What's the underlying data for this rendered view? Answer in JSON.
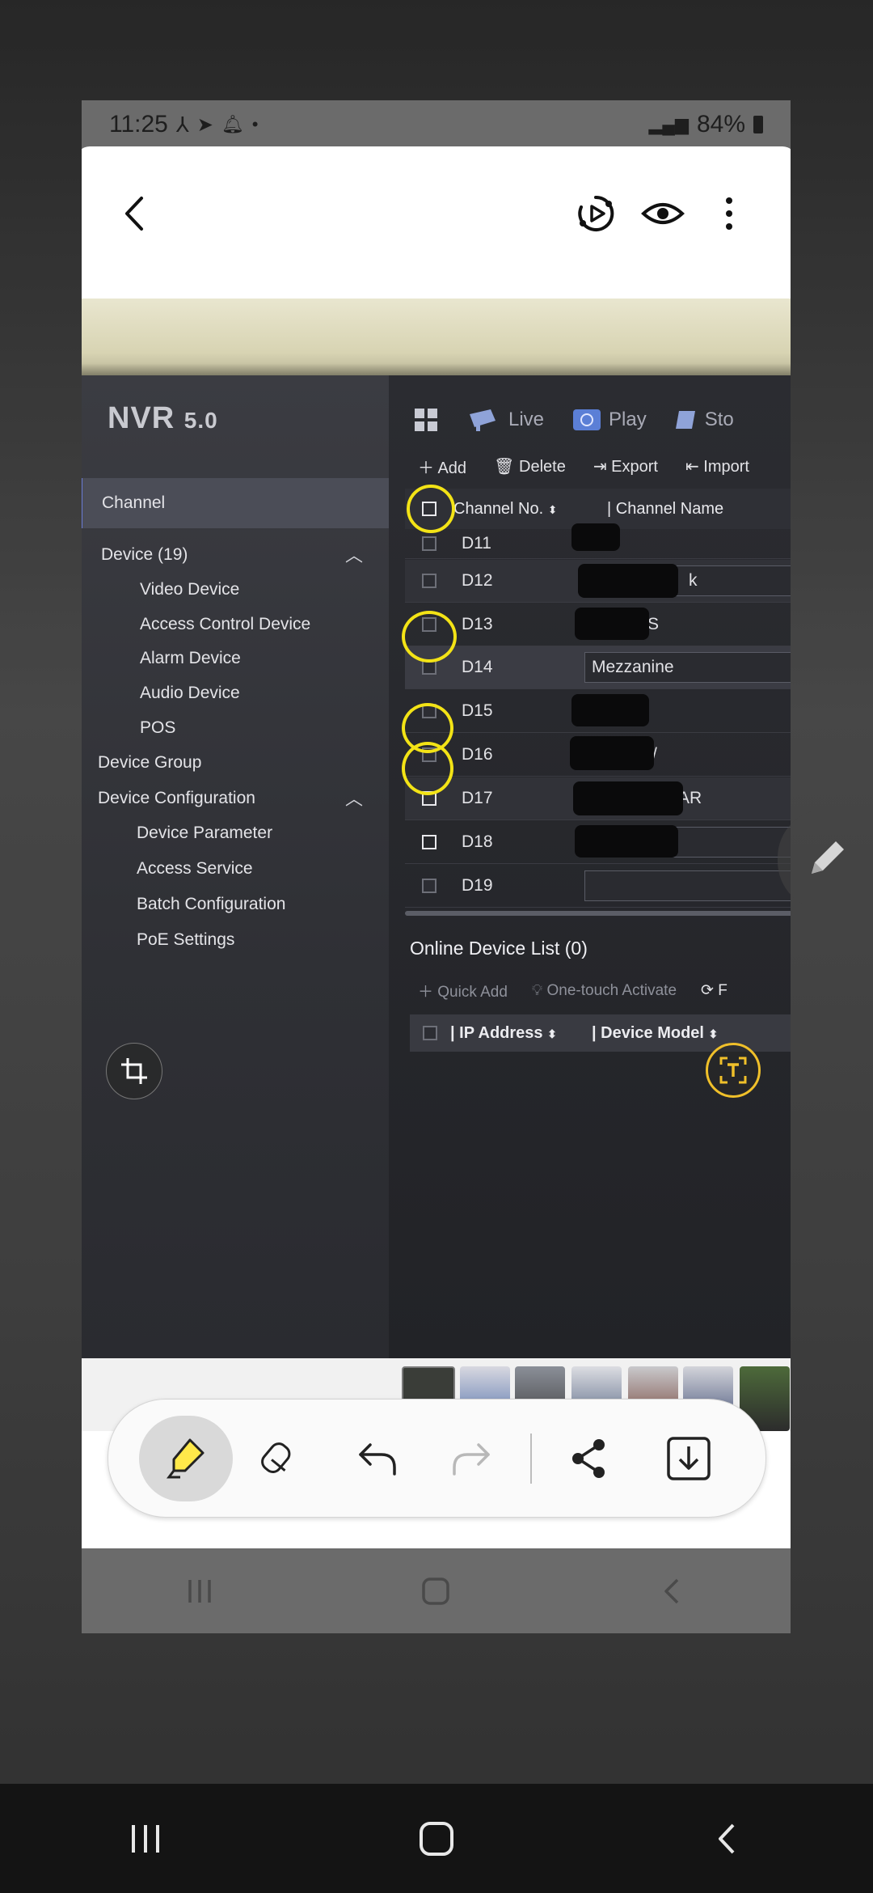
{
  "status_bar": {
    "time": "11:25",
    "battery": "84%"
  },
  "editor": {
    "back_icon": "chevron-left-icon",
    "actions": [
      "play-circle-icon",
      "eye-icon",
      "more-vert-icon"
    ]
  },
  "nvr": {
    "logo_main": "NVR",
    "logo_version": "5.0",
    "top_tabs": [
      {
        "label": "Live",
        "icon": "camera-icon"
      },
      {
        "label": "Play",
        "icon": "playback-icon"
      },
      {
        "label": "Sto",
        "icon": "storage-icon"
      }
    ],
    "sidebar": {
      "channel": "Channel",
      "device": "Device (19)",
      "device_items": [
        "Video Device",
        "Access Control Device",
        "Alarm Device",
        "Audio Device",
        "POS"
      ],
      "device_group": "Device Group",
      "device_configuration": "Device Configuration",
      "config_items": [
        "Device Parameter",
        "Access Service",
        "Batch Configuration",
        "PoE Settings"
      ]
    },
    "toolbar": {
      "add": "Add",
      "delete": "Delete",
      "export": "Export",
      "import": "Import"
    },
    "table": {
      "col_channel_no": "Channel No.",
      "col_channel_name": "| Channel Name",
      "rows": [
        {
          "channel": "D11",
          "name": ""
        },
        {
          "channel": "D12",
          "name": "k"
        },
        {
          "channel": "D13",
          "name": "S"
        },
        {
          "channel": "D14",
          "name": "Mezzanine"
        },
        {
          "channel": "D15",
          "name": ""
        },
        {
          "channel": "D16",
          "name": "/"
        },
        {
          "channel": "D17",
          "name": "AR"
        },
        {
          "channel": "D18",
          "name": ""
        },
        {
          "channel": "D19",
          "name": ""
        }
      ]
    },
    "online": {
      "title": "Online Device List (0)",
      "quick_add": "Quick Add",
      "one_touch": "One-touch Activate",
      "refresh_partial": "F",
      "col_ip": "| IP Address",
      "col_model": "| Device Model"
    },
    "annotation_color": "#f3e316"
  },
  "bottom_tools": [
    "highlighter-icon",
    "eraser-icon",
    "undo-icon",
    "redo-icon",
    "share-icon",
    "download-icon"
  ]
}
